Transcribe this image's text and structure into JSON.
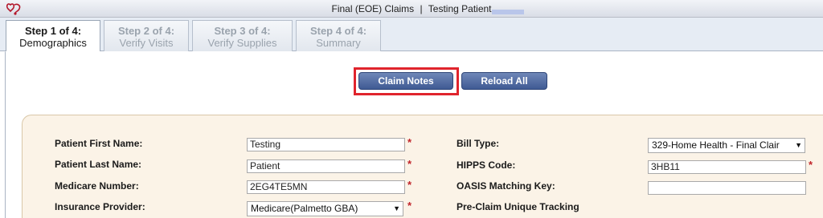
{
  "window": {
    "title_left": "Final (EOE) Claims",
    "title_separator": "|",
    "title_right": "Testing Patient",
    "logo_icon": "stethoscope-heart-icon"
  },
  "tabs": [
    {
      "step": "Step 1 of 4:",
      "label": "Demographics",
      "active": true
    },
    {
      "step": "Step 2 of 4:",
      "label": "Verify Visits",
      "active": false
    },
    {
      "step": "Step 3 of 4:",
      "label": "Verify Supplies",
      "active": false
    },
    {
      "step": "Step 4 of 4:",
      "label": "Summary",
      "active": false
    }
  ],
  "actions": {
    "claim_notes": "Claim Notes",
    "reload_all": "Reload All"
  },
  "form": {
    "left": [
      {
        "label": "Patient First Name:",
        "value": "Testing",
        "required": "*"
      },
      {
        "label": "Patient Last Name:",
        "value": "Patient",
        "required": "*"
      },
      {
        "label": "Medicare Number:",
        "value": "2EG4TE5MN",
        "required": "*"
      },
      {
        "label": "Insurance Provider:",
        "value": "Medicare(Palmetto GBA)",
        "required": "*"
      }
    ],
    "right": [
      {
        "label": "Bill Type:",
        "value": "329-Home Health - Final Clair"
      },
      {
        "label": "HIPPS Code:",
        "value": "3HB11",
        "required": "*"
      },
      {
        "label": "OASIS Matching Key:",
        "value": ""
      },
      {
        "label": "Pre-Claim Unique Tracking",
        "value": ""
      }
    ]
  },
  "colors": {
    "button": "#4a649c",
    "highlight": "#e0242c",
    "panel": "#fbf3e7",
    "required": "#c0242a"
  }
}
